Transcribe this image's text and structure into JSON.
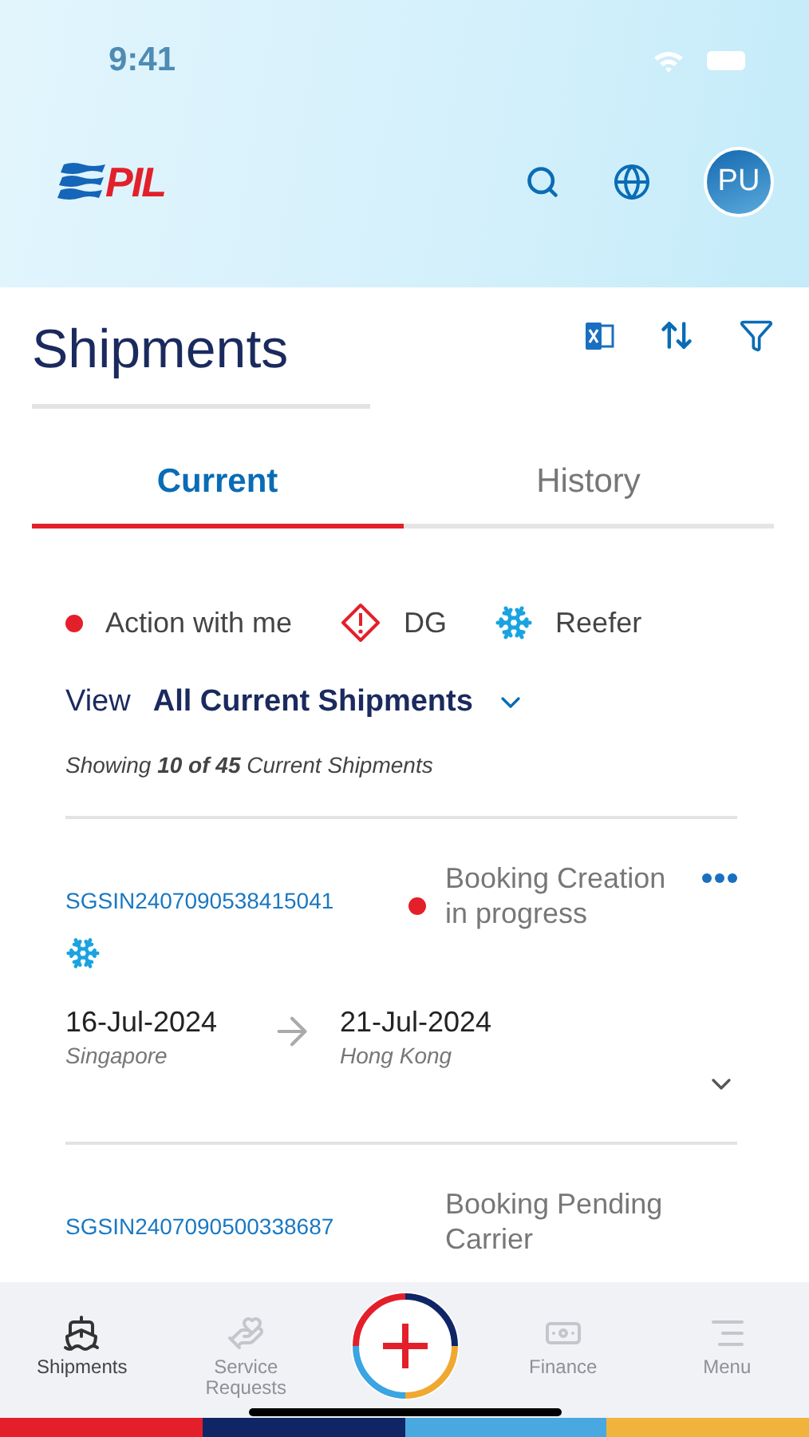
{
  "status_bar": {
    "time": "9:41"
  },
  "header": {
    "logo": "PIL",
    "avatar": "PU"
  },
  "page": {
    "title": "Shipments"
  },
  "tabs": [
    {
      "label": "Current",
      "selected": true
    },
    {
      "label": "History",
      "selected": false
    }
  ],
  "legend": [
    {
      "kind": "action",
      "label": "Action with me"
    },
    {
      "kind": "dg",
      "label": "DG"
    },
    {
      "kind": "reefer",
      "label": "Reefer"
    }
  ],
  "view": {
    "label": "View",
    "value": "All Current Shipments"
  },
  "summary": "Showing **10 of 45** Current Shipments",
  "shipments": [
    {
      "id": "SGSIN2407090538415041",
      "action": true,
      "reefer": true,
      "status": "Booking Creation in progress",
      "departure_date": "16-Jul-2024",
      "origin": "Singapore",
      "arrival_date": "21-Jul-2024",
      "destination": "Hong Kong"
    },
    {
      "id": "SGSIN2407090500338687",
      "action": false,
      "reefer": false,
      "status": "Booking Pending Carrier"
    }
  ],
  "bottom_nav": [
    {
      "kind": "ship",
      "label": "Shipments",
      "selected": true
    },
    {
      "kind": "service",
      "label": "Service Requests",
      "selected": false
    },
    {
      "kind": "add"
    },
    {
      "kind": "finance",
      "label": "Finance",
      "selected": false
    },
    {
      "kind": "menu",
      "label": "Menu",
      "selected": false
    }
  ]
}
